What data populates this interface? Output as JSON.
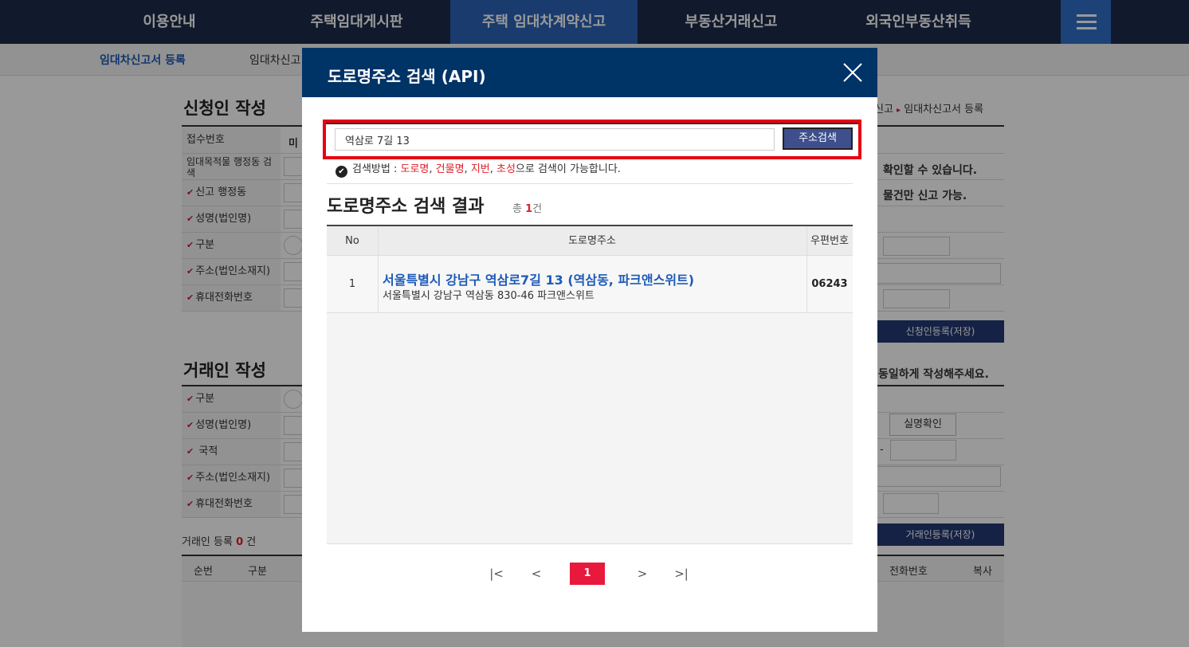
{
  "topnav": {
    "items": [
      "이용안내",
      "주택임대게시판",
      "주택 임대차계약신고",
      "부동산거래신고",
      "외국인부동산취득"
    ],
    "active_index": 2,
    "menu_icon": "hamburger-icon"
  },
  "subnav": {
    "items": [
      "임대차신고서 등록",
      "임대차신고"
    ]
  },
  "background": {
    "applicant_title": "신청인 작성",
    "breadcrumb": [
      "신고",
      "임대차신고서 등록"
    ],
    "applicant_rows": [
      "접수번호",
      "임대목적물 행정동 검색",
      "신고 행정동",
      "성명(법인명)",
      "구분",
      "주소(법인소재지)",
      "휴대전화번호"
    ],
    "receipt_value": "미",
    "right_notes": [
      "확인할 수 있습니다.",
      "물건만 신고 가능."
    ],
    "applicant_save": "신청인등록(저장)",
    "trader_title": "거래인 작성",
    "trader_note": "동일하게 작성해주세요.",
    "trader_rows": [
      "구분",
      "성명(법인명)",
      "국적",
      "주소(법인소재지)",
      "휴대전화번호"
    ],
    "realname_btn": "실명확인",
    "trader_save": "거래인등록(저장)",
    "trader_count_label": "거래인 등록",
    "trader_count": "0",
    "trader_count_unit": "건",
    "list_cols": [
      "순번",
      "구분",
      "전화번호",
      "복사"
    ],
    "dash": "-"
  },
  "modal": {
    "title": "도로명주소 검색 (API)",
    "search_value": "역삼로 7길 13",
    "search_button": "주소검색",
    "hint_prefix": "검색방법 :",
    "hint_terms": [
      "도로명",
      "건물명",
      "지번",
      "초성"
    ],
    "hint_suffix": "으로 검색이 가능합니다.",
    "result_title": "도로명주소 검색 결과",
    "result_count_prefix": "총",
    "result_count": "1",
    "result_count_unit": "건",
    "table_headers": [
      "No",
      "도로명주소",
      "우편번호"
    ],
    "rows": [
      {
        "no": "1",
        "road_address": "서울특별시 강남구 역삼로7길 13 (역삼동, 파크앤스위트)",
        "jibun_address": "서울특별시 강남구 역삼동 830-46 파크앤스위트",
        "zip": "06243"
      }
    ],
    "pagination": {
      "first": "|<",
      "prev": "<",
      "current": "1",
      "next": ">",
      "last": ">|"
    }
  },
  "colors": {
    "nav_bg": "#1d2a4a",
    "nav_active": "#2a63b8",
    "modal_header": "#003366",
    "highlight_frame": "#e60012",
    "link_blue": "#1e5bb8",
    "page_active": "#e8193c"
  }
}
